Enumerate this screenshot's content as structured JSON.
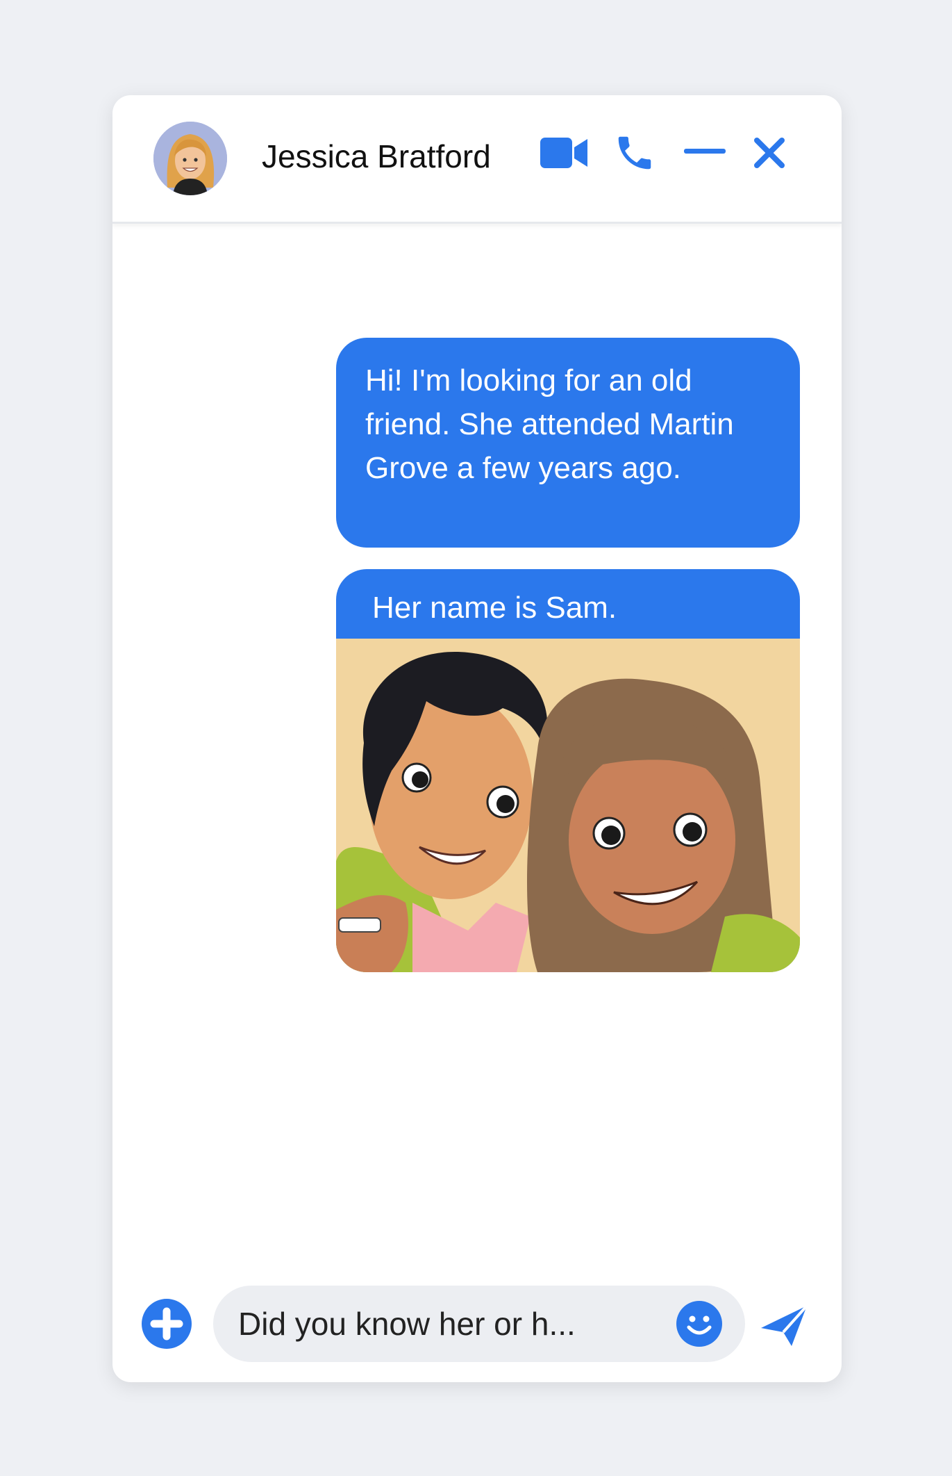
{
  "header": {
    "contact_name": "Jessica Bratford",
    "icons": [
      "video-call-icon",
      "phone-icon",
      "minimize-icon",
      "close-icon"
    ]
  },
  "messages": [
    {
      "sender": "me",
      "text": "Hi! I'm looking for an old friend. She attended Martin Grove a few years ago."
    },
    {
      "sender": "me",
      "text": "Her name is Sam.",
      "attachment": "illustrated photo of two friends"
    }
  ],
  "composer": {
    "value": "Did you know her or h...",
    "icons": [
      "add-icon",
      "emoji-icon",
      "send-icon"
    ]
  },
  "colors": {
    "accent": "#2b78ec",
    "page_background": "#eef0f4",
    "input_background": "#eceef2"
  }
}
